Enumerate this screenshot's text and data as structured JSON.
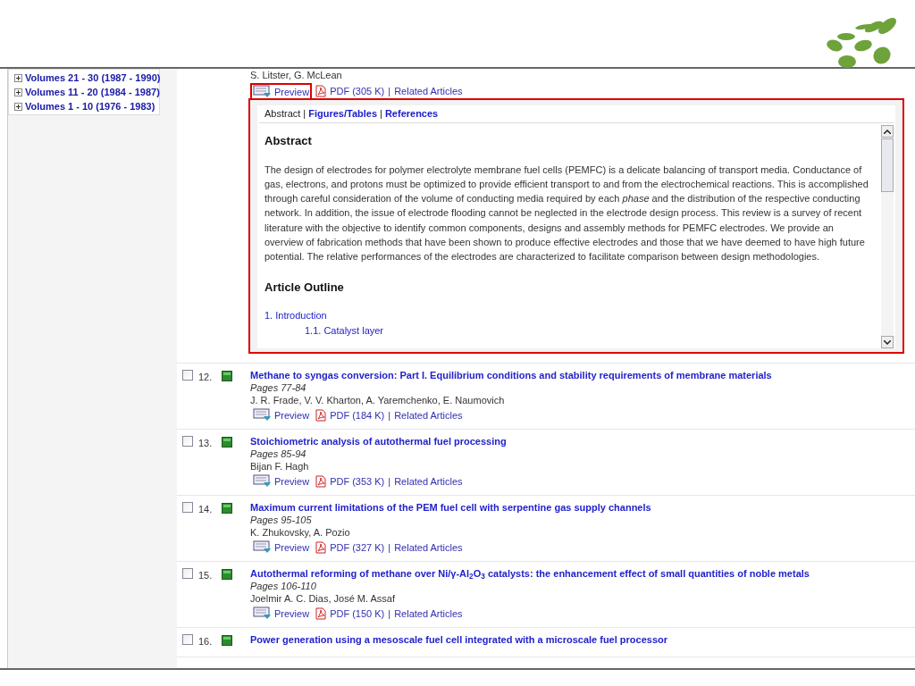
{
  "sidebar": {
    "volumes": [
      {
        "label": "Volumes 21 - 30 (1987 - 1990)",
        "expanded": false
      },
      {
        "label": "Volumes 11 - 20 (1984 - 1987)",
        "expanded": false
      },
      {
        "label": "Volumes 1 - 10 (1976 - 1983)",
        "expanded": false
      }
    ]
  },
  "articles": [
    {
      "authors": "S. Litster, G. McLean",
      "preview": "Preview",
      "pdf": "PDF (305 K)",
      "separator": "|",
      "related": "Related Articles",
      "expanded": true,
      "panel": {
        "tabs": [
          {
            "label": "Abstract",
            "selected": true
          },
          {
            "label": "Figures/Tables",
            "selected": false
          },
          {
            "label": "References",
            "selected": false
          }
        ],
        "tab_separators": [
          "|",
          "|"
        ],
        "heading": "Abstract",
        "abstract": "The design of electrodes for polymer electrolyte membrane fuel cells (PEMFC) is a delicate balancing of transport media. Conductance of gas, electrons, and protons must be optimized to provide efficient transport to and from the electrochemical reactions. This is accomplished through careful consideration of the volume of conducting media required by each *phase* and the distribution of the respective conducting network. In addition, the issue of electrode flooding cannot be neglected in the electrode design process. This review is a survey of recent literature with the objective to identify common components, designs and assembly methods for PEMFC electrodes. We provide an overview of fabrication methods that have been shown to produce effective electrodes and those that we have deemed to have high future potential. The relative performances of the electrodes are characterized to facilitate comparison between design methodologies.",
        "outline_heading": "Article Outline",
        "outline": [
          {
            "label": "1. Introduction",
            "children": [
              {
                "label": "1.1. Catalyst layer"
              }
            ]
          }
        ]
      }
    },
    {
      "checked": false,
      "number": "12.",
      "title": "Methane to syngas conversion: Part I. Equilibrium conditions and stability requirements of membrane materials",
      "pages": "Pages 77-84",
      "authors": "J. R. Frade, V. V. Kharton, A. Yaremchenko, E. Naumovich",
      "preview": "Preview",
      "pdf": "PDF (184 K)",
      "separator": "|",
      "related": "Related Articles",
      "expanded": false
    },
    {
      "checked": false,
      "number": "13.",
      "title": "Stoichiometric analysis of autothermal fuel processing",
      "pages": "Pages 85-94",
      "authors": "Bijan F. Hagh",
      "preview": "Preview",
      "pdf": "PDF (353 K)",
      "separator": "|",
      "related": "Related Articles",
      "expanded": false
    },
    {
      "checked": false,
      "number": "14.",
      "title": "Maximum current limitations of the PEM fuel cell with serpentine gas supply channels",
      "pages": "Pages 95-105",
      "authors": "K. Zhukovsky, A. Pozio",
      "preview": "Preview",
      "pdf": "PDF (327 K)",
      "separator": "|",
      "related": "Related Articles",
      "expanded": false
    },
    {
      "checked": false,
      "number": "15.",
      "title": "Autothermal reforming of methane over Ni/γ-Al$_{2}$O$_{3}$ catalysts: the enhancement effect of small quantities of noble metals",
      "pages": "Pages 106-110",
      "authors": "Joelmir A. C. Dias, José M. Assaf",
      "preview": "Preview",
      "pdf": "PDF (150 K)",
      "separator": "|",
      "related": "Related Articles",
      "expanded": false
    },
    {
      "checked": false,
      "number": "16.",
      "title": "Power generation using a mesoscale fuel cell integrated with a microscale fuel processor"
    }
  ]
}
